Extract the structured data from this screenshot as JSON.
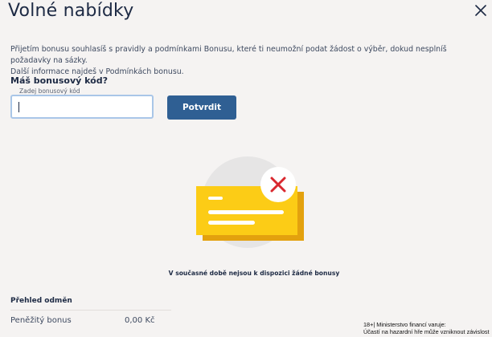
{
  "header": {
    "title": "Volné nabídky",
    "close_icon": "close-icon"
  },
  "info": {
    "text_line1": "Přijetím bonusu souhlasíš s pravidly a podmínkami Bonusu, které ti neumožní podat žádost o výběr, dokud nesplníš požadavky na sázky.",
    "text_line2": "Další informace najdeš v Podmínkách bonusu."
  },
  "bonus_code": {
    "question": "Máš bonusový kód?",
    "field_label": "Zadej bonusový kód",
    "field_value": "",
    "confirm_label": "Potvrdit"
  },
  "empty_state": {
    "message": "V současné době nejsou k dispozici žádné bonusy",
    "illustration_icon": "empty-bonus-card-with-x-icon"
  },
  "rewards": {
    "title": "Přehled odměn",
    "items": [
      {
        "name": "Peněžitý bonus",
        "value": "0,00 Kč"
      }
    ]
  },
  "footer": {
    "legal_line1": "18+| Ministerstvo financí varuje:",
    "legal_line2": "Účastí na hazardní hře může vzniknout závislost"
  },
  "colors": {
    "background": "#f5f3f2",
    "primary_button": "#2f5f93",
    "card_yellow": "#fccc16",
    "card_shadow": "#e3a10e",
    "circle": "#e6e5e5",
    "x_red": "#d9282f"
  }
}
